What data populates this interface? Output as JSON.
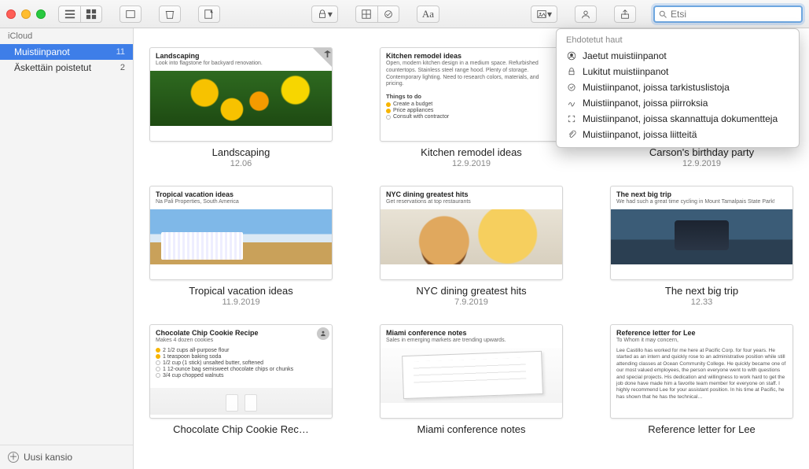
{
  "toolbar": {
    "search_placeholder": "Etsi"
  },
  "sidebar": {
    "section": "iCloud",
    "items": [
      {
        "label": "Muistiinpanot",
        "count": "11",
        "selected": true
      },
      {
        "label": "Äskettäin poistetut",
        "count": "2",
        "selected": false
      }
    ],
    "new_folder": "Uusi kansio"
  },
  "suggestions": {
    "header": "Ehdotetut haut",
    "items": [
      {
        "icon": "person-circle",
        "label": "Jaetut muistiinpanot"
      },
      {
        "icon": "lock",
        "label": "Lukitut muistiinpanot"
      },
      {
        "icon": "checklist",
        "label": "Muistiinpanot, joissa tarkistuslistoja"
      },
      {
        "icon": "scribble",
        "label": "Muistiinpanot, joissa piirroksia"
      },
      {
        "icon": "scan",
        "label": "Muistiinpanot, joissa skannattuja dokumentteja"
      },
      {
        "icon": "paperclip",
        "label": "Muistiinpanot, joissa liitteitä"
      }
    ]
  },
  "notes": [
    {
      "title": "Landscaping",
      "date": "12.06",
      "thumb_header": "Landscaping",
      "thumb_sub": "Look into flagstone for backyard renovation.",
      "art": "flowers",
      "pinned": true
    },
    {
      "title": "Kitchen remodel ideas",
      "date": "12.9.2019",
      "thumb_header": "Kitchen remodel ideas",
      "thumb_sub": "Open, modern kitchen design in a medium space. Refurbished countertops. Stainless steel range hood. Plenty of storage. Contemporary lighting. Need to research colors, materials, and pricing.",
      "todo_header": "Things to do",
      "todo": [
        {
          "done": true,
          "text": "Create a budget"
        },
        {
          "done": true,
          "text": "Price appliances"
        },
        {
          "done": false,
          "text": "Consult with contractor"
        }
      ],
      "art": "todo"
    },
    {
      "title": "Carson's birthday party",
      "date": "12.9.2019",
      "thumb_header": "",
      "thumb_sub": "",
      "art": "balloons"
    },
    {
      "title": "Tropical vacation ideas",
      "date": "11.9.2019",
      "thumb_header": "Tropical vacation ideas",
      "thumb_sub": "Na Pali Properties, South America",
      "art": "beach"
    },
    {
      "title": "NYC dining greatest hits",
      "date": "7.9.2019",
      "thumb_header": "NYC dining greatest hits",
      "thumb_sub": "Get reservations at top restaurants",
      "art": "burger"
    },
    {
      "title": "The next big trip",
      "date": "12.33",
      "thumb_header": "The next big trip",
      "thumb_sub": "We had such a great time cycling in Mount Tamalpais State Park!",
      "art": "biketrip"
    },
    {
      "title": "Chocolate Chip Cookie Rec…",
      "date": "",
      "thumb_header": "Chocolate Chip Cookie Recipe",
      "thumb_sub": "Makes 4 dozen cookies",
      "todo": [
        {
          "done": true,
          "text": "2 1/2 cups all-purpose flour"
        },
        {
          "done": true,
          "text": "1 teaspoon baking soda"
        },
        {
          "done": false,
          "text": "1/2 cup (1 stick) unsalted butter, softened"
        },
        {
          "done": false,
          "text": "1 12-ounce bag semisweet chocolate chips or chunks"
        },
        {
          "done": false,
          "text": "3/4 cup chopped walnuts"
        }
      ],
      "art": "cookies",
      "shared": true
    },
    {
      "title": "Miami conference notes",
      "date": "",
      "thumb_header": "Miami conference notes",
      "thumb_sub": "Sales in emerging markets are trending upwards.",
      "art": "notebook"
    },
    {
      "title": "Reference letter for Lee",
      "date": "",
      "thumb_header": "Reference letter for Lee",
      "thumb_sub": "To Whom it may concern,",
      "body": "Lee Castillo has worked for me here at Pacific Corp. for four years. He started as an intern and quickly rose to an administrative position while still attending classes at Ocean Community College.\n\nHe quickly became one of our most valued employees, the person everyone went to with questions and special projects. His dedication and willingness to work hard to get the job done have made him a favorite team member for everyone on staff.\n\nI highly recommend Lee for your assistant position. In his time at Pacific, he has shown that he has the technical…",
      "art": "textonly"
    }
  ]
}
